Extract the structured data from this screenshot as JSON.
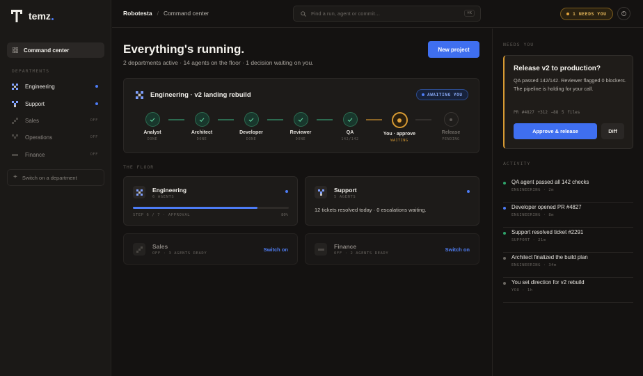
{
  "brand": {
    "name": "temz"
  },
  "sidebar": {
    "command_center": "Command center",
    "departments_label": "DEPARTMENTS",
    "departments": [
      {
        "name": "Engineering",
        "state": "active"
      },
      {
        "name": "Support",
        "state": "active"
      },
      {
        "name": "Sales",
        "state": "OFF"
      },
      {
        "name": "Operations",
        "state": "OFF"
      },
      {
        "name": "Finance",
        "state": "OFF"
      }
    ],
    "switch_on": "Switch on a department"
  },
  "topbar": {
    "org": "Robotesta",
    "separator": "/",
    "page": "Command center",
    "search_placeholder": "Find a run, agent or commit…",
    "search_shortcut": "⌘K",
    "needs_you": "1 NEEDS YOU"
  },
  "main": {
    "headline": "Everything's running.",
    "subline": "2 departments active · 14 agents on the floor · 1 decision waiting on you.",
    "new_project": "New project",
    "pipeline": {
      "title": "Engineering · v2 landing rebuild",
      "badge": "AWAITING YOU",
      "stages": [
        {
          "name": "Analyst",
          "status": "DONE",
          "state": "done"
        },
        {
          "name": "Architect",
          "status": "DONE",
          "state": "done"
        },
        {
          "name": "Developer",
          "status": "DONE",
          "state": "done"
        },
        {
          "name": "Reviewer",
          "status": "DONE",
          "state": "done"
        },
        {
          "name": "QA",
          "status": "142/142",
          "state": "done"
        },
        {
          "name": "You · approve",
          "status": "WAITING",
          "state": "waiting"
        },
        {
          "name": "Release",
          "status": "PENDING",
          "state": "pending"
        }
      ]
    },
    "floor_label": "THE FLOOR",
    "floor": {
      "engineering": {
        "title": "Engineering",
        "agents": "6 AGENTS",
        "step": "STEP 6 / 7 · APPROVAL",
        "percent": "80%",
        "progress": 0.8
      },
      "support": {
        "title": "Support",
        "agents": "5 AGENTS",
        "desc": "12 tickets resolved today · 0 escalations waiting."
      },
      "sales": {
        "title": "Sales",
        "meta": "OFF · 3 AGENTS READY",
        "action": "Switch on"
      },
      "finance": {
        "title": "Finance",
        "meta": "OFF · 2 AGENTS READY",
        "action": "Switch on"
      }
    }
  },
  "right": {
    "needs_label": "NEEDS YOU",
    "release": {
      "title": "Release v2 to production?",
      "body": "QA passed 142/142. Reviewer flagged 0 blockers. The pipeline is holding for your call.",
      "meta": "PR #4827   +312 −88   5 files",
      "approve": "Approve & release",
      "diff": "Diff"
    },
    "activity_label": "ACTIVITY",
    "activity": [
      {
        "text": "QA agent passed all 142 checks",
        "meta": "ENGINEERING · 2m",
        "color": "#2fa36b"
      },
      {
        "text": "Developer opened PR #4827",
        "meta": "ENGINEERING · 8m",
        "color": "#4d7cf6"
      },
      {
        "text": "Support resolved ticket #2291",
        "meta": "SUPPORT · 21m",
        "color": "#2fa36b"
      },
      {
        "text": "Architect finalized the build plan",
        "meta": "ENGINEERING · 34m",
        "color": "#6b6762"
      },
      {
        "text": "You set direction for v2 rebuild",
        "meta": "YOU · 1h",
        "color": "#6b6762"
      }
    ]
  },
  "colors": {
    "accent": "#3f6ff0",
    "amber": "#d79a33",
    "success": "#2fa36b"
  }
}
